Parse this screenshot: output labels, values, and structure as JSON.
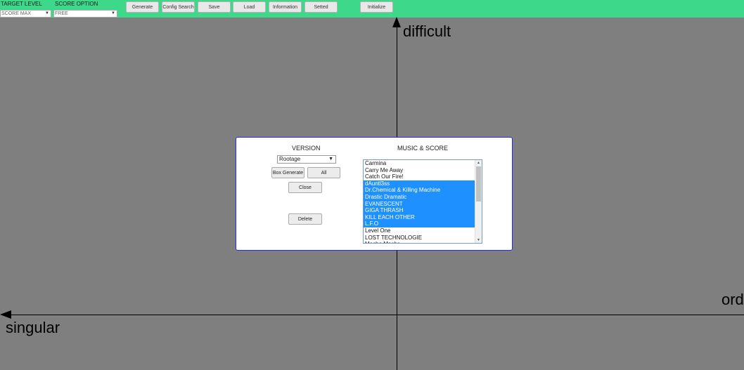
{
  "toolbar": {
    "target_level_label": "TARGET LEVEL",
    "target_level_value": "SCORE MAX",
    "score_option_label": "SCORE OPTION",
    "score_option_value": "FREE",
    "buttons": [
      "Generate",
      "Config Search",
      "Save",
      "Load",
      "Information",
      "Setted",
      "Initialize"
    ]
  },
  "axes": {
    "top": "difficult",
    "left": "singular",
    "right": "ord"
  },
  "modal": {
    "version_title": "VERSION",
    "version_value": "Rootage",
    "box_generate_label": "Box Generate",
    "all_label": "All",
    "close_label": "Close",
    "delete_label": "Delete",
    "music_title": "MUSIC & SCORE",
    "music_list": [
      {
        "name": "Carmina",
        "selected": false
      },
      {
        "name": "Carry Me Away",
        "selected": false
      },
      {
        "name": "Catch Our Fire!",
        "selected": false
      },
      {
        "name": "dAuntl3ss",
        "selected": true
      },
      {
        "name": "Dr.Chemical & Killing Machine",
        "selected": true
      },
      {
        "name": "Drastic Dramatic",
        "selected": true
      },
      {
        "name": "EVANESCENT",
        "selected": true
      },
      {
        "name": "GIGA THRASH",
        "selected": true
      },
      {
        "name": "KILL EACH OTHER",
        "selected": true
      },
      {
        "name": "L.F.O",
        "selected": true
      },
      {
        "name": "Level One",
        "selected": false
      },
      {
        "name": "LOST TECHNOLOGIE",
        "selected": false
      },
      {
        "name": "Mecha Mecha",
        "selected": false
      }
    ]
  },
  "colors": {
    "toolbar_bg": "#3dd88a",
    "canvas_bg": "#7f7f7f",
    "selected_bg": "#1e90ff",
    "modal_border": "#2b2bd6"
  }
}
